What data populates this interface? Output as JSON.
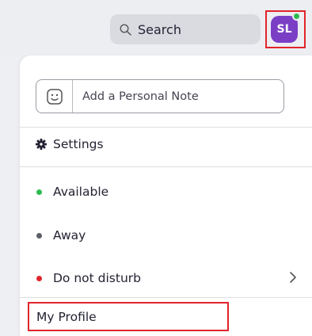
{
  "search": {
    "label": "Search",
    "icon": "search-icon"
  },
  "avatar": {
    "initials": "SL",
    "color": "#7b3fc6",
    "presence_color": "#2dbb4f"
  },
  "note": {
    "placeholder": "Add a Personal Note",
    "icon": "smiley-icon"
  },
  "menu": {
    "settings_label": "Settings",
    "status_items": [
      {
        "label": "Available",
        "color": "#2dbb4f"
      },
      {
        "label": "Away",
        "color": "#5c5f66"
      },
      {
        "label": "Do not disturb",
        "color": "#e0242b"
      }
    ],
    "profile_label": "My Profile"
  },
  "highlight_color": "#e0242b"
}
